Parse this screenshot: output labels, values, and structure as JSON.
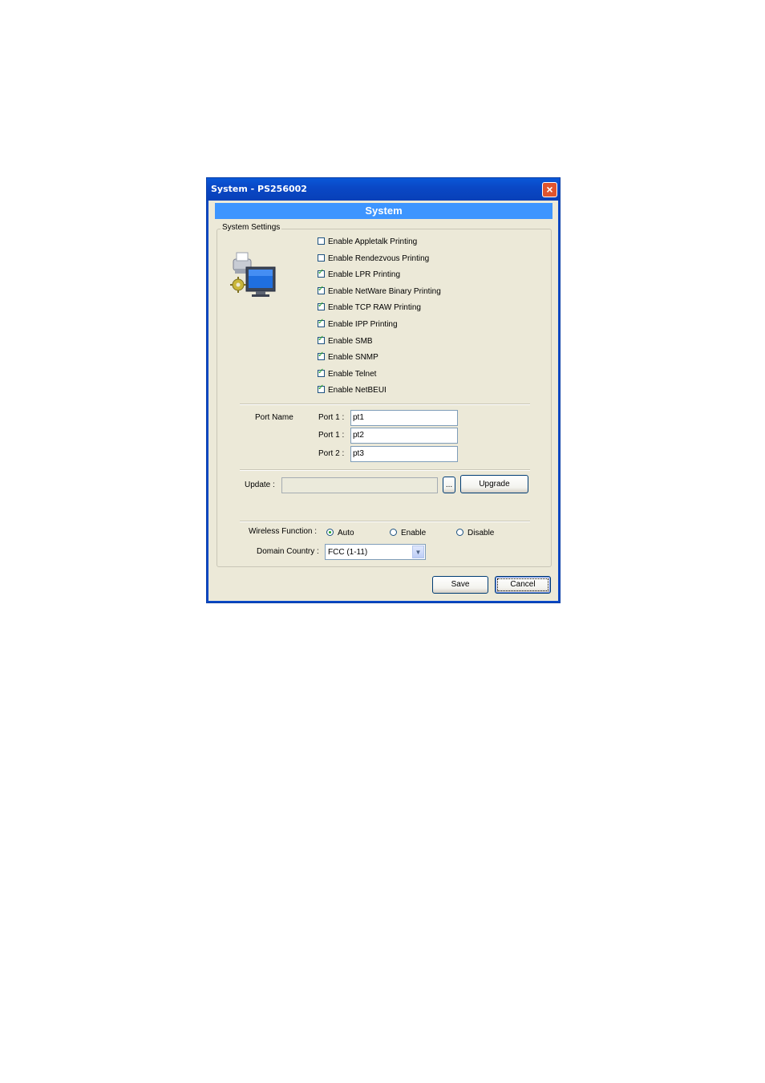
{
  "window": {
    "title": "System - PS256002",
    "close_icon": "×"
  },
  "header": {
    "title": "System"
  },
  "settings": {
    "group_caption": "System Settings",
    "options": [
      {
        "label": "Enable Appletalk Printing",
        "checked": false
      },
      {
        "label": "Enable Rendezvous Printing",
        "checked": false
      },
      {
        "label": "Enable LPR Printing",
        "checked": true
      },
      {
        "label": "Enable NetWare Binary Printing",
        "checked": true
      },
      {
        "label": "Enable TCP RAW Printing",
        "checked": true
      },
      {
        "label": "Enable IPP Printing",
        "checked": true
      },
      {
        "label": "Enable SMB",
        "checked": true
      },
      {
        "label": "Enable SNMP",
        "checked": true
      },
      {
        "label": "Enable Telnet",
        "checked": true
      },
      {
        "label": "Enable NetBEUI",
        "checked": true
      }
    ]
  },
  "ports": {
    "section_label": "Port Name",
    "items": [
      {
        "label": "Port 1 :",
        "value": "pt1"
      },
      {
        "label": "Port 1 :",
        "value": "pt2"
      },
      {
        "label": "Port 2 :",
        "value": "pt3"
      }
    ]
  },
  "update": {
    "label": "Update :",
    "value": "",
    "browse_label": "...",
    "upgrade_label": "Upgrade"
  },
  "wireless": {
    "label": "Wireless Function :",
    "options": [
      {
        "label": "Auto",
        "selected": true
      },
      {
        "label": "Enable",
        "selected": false
      },
      {
        "label": "Disable",
        "selected": false
      }
    ],
    "domain_label": "Domain Country :",
    "domain_value": "FCC (1-11)"
  },
  "buttons": {
    "save": "Save",
    "cancel": "Cancel"
  },
  "colors": {
    "title_bar": "#0a48c6",
    "banner": "#3d95ff",
    "dialog_bg": "#ece9d8",
    "check": "#21a121"
  }
}
